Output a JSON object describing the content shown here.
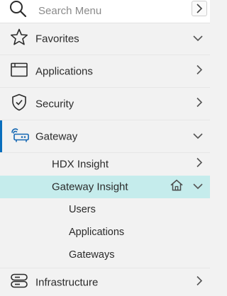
{
  "search": {
    "placeholder": "Search Menu"
  },
  "menu": {
    "favorites": "Favorites",
    "applications": "Applications",
    "security": "Security",
    "gateway": "Gateway",
    "infrastructure": "Infrastructure"
  },
  "gateway_sub": {
    "hdx_insight": "HDX Insight",
    "gateway_insight": "Gateway Insight"
  },
  "gateway_insight_items": [
    {
      "label": "Users"
    },
    {
      "label": "Applications"
    },
    {
      "label": "Gateways"
    }
  ],
  "colors": {
    "active_bar": "#0a6ebd",
    "selected_bg": "#c5ecec",
    "gateway_icon": "#1467b3"
  },
  "icons": {
    "search": "search-icon",
    "collapse": "chevron-right-icon",
    "favorites": "star-icon",
    "applications": "window-icon",
    "security": "shield-check-icon",
    "gateway": "gateway-icon",
    "infrastructure": "server-icon",
    "home": "home-icon"
  }
}
